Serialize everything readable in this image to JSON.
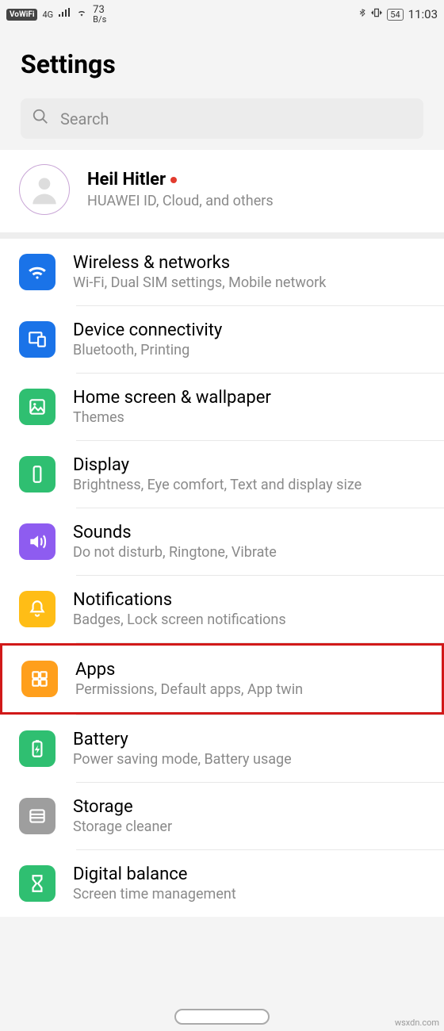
{
  "statusbar": {
    "vowifi": "VoWiFi",
    "net_type": "4G",
    "speed_num": "73",
    "speed_unit": "B/s",
    "battery": "54",
    "time": "11:03"
  },
  "page": {
    "title": "Settings"
  },
  "search": {
    "placeholder": "Search"
  },
  "account": {
    "name": "Heil Hitler",
    "sub": "HUAWEI ID, Cloud, and others"
  },
  "items": [
    {
      "icon": "wifi-icon",
      "color": "c-blue",
      "title": "Wireless & networks",
      "sub": "Wi-Fi, Dual SIM settings, Mobile network",
      "hl": false
    },
    {
      "icon": "devices-icon",
      "color": "c-blue2",
      "title": "Device connectivity",
      "sub": "Bluetooth, Printing",
      "hl": false
    },
    {
      "icon": "wallpaper-icon",
      "color": "c-green",
      "title": "Home screen & wallpaper",
      "sub": "Themes",
      "hl": false
    },
    {
      "icon": "display-icon",
      "color": "c-green2",
      "title": "Display",
      "sub": "Brightness, Eye comfort, Text and display size",
      "hl": false
    },
    {
      "icon": "sound-icon",
      "color": "c-purple",
      "title": "Sounds",
      "sub": "Do not disturb, Ringtone, Vibrate",
      "hl": false
    },
    {
      "icon": "bell-icon",
      "color": "c-yellow",
      "title": "Notifications",
      "sub": "Badges, Lock screen notifications",
      "hl": false
    },
    {
      "icon": "apps-icon",
      "color": "c-orange",
      "title": "Apps",
      "sub": "Permissions, Default apps, App twin",
      "hl": true
    },
    {
      "icon": "battery-icon",
      "color": "c-green",
      "title": "Battery",
      "sub": "Power saving mode, Battery usage",
      "hl": false
    },
    {
      "icon": "storage-icon",
      "color": "c-gray",
      "title": "Storage",
      "sub": "Storage cleaner",
      "hl": false
    },
    {
      "icon": "hourglass-icon",
      "color": "c-green2",
      "title": "Digital balance",
      "sub": "Screen time management",
      "hl": false
    }
  ],
  "watermark": "wsxdn.com"
}
